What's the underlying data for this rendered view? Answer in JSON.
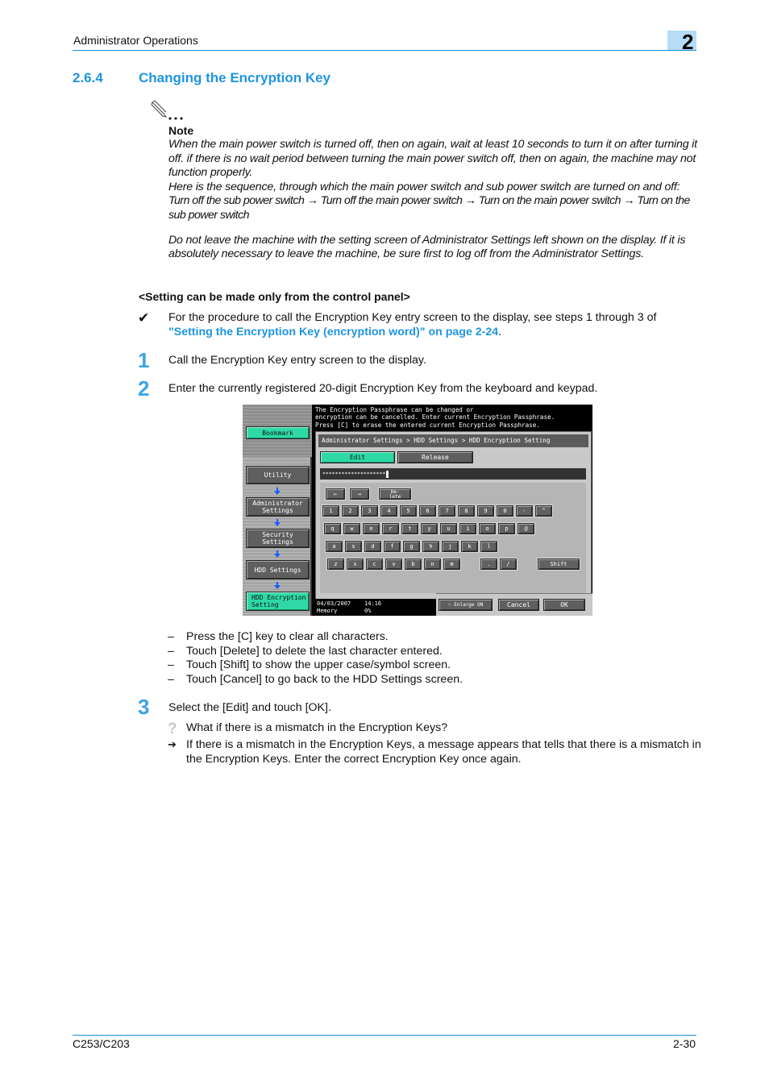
{
  "header": {
    "section_title": "Administrator Operations",
    "chapter_number": "2"
  },
  "section": {
    "number": "2.6.4",
    "title": "Changing the Encryption Key"
  },
  "note": {
    "icon": "pencil-note-icon",
    "label": "Note",
    "paragraphs": [
      "When the main power switch is turned off, then on again, wait at least 10 seconds to turn it on after turning it off. if there is no wait period between turning the main power switch off, then on again, the machine may not function properly.",
      "Here is the sequence, through which the main power switch and sub power switch are turned on and off:",
      "Turn off the sub power switch → Turn off the main power switch → Turn on the main power switch → Turn on the sub power switch",
      "Do not leave the machine with the setting screen of Administrator Settings left shown on the display. If it is absolutely necessary to leave the machine, be sure first to log off from the Administrator Settings."
    ]
  },
  "control_panel_heading": "<Setting can be made only from the control panel>",
  "prerequisite": {
    "icon": "checkmark-icon",
    "text_before": "For the procedure to call the Encryption Key entry screen to the display, see steps 1 through 3 of ",
    "link_text": "\"Setting the Encryption Key (encryption word)\" on page 2-24",
    "text_after": "."
  },
  "steps": [
    {
      "number": "1",
      "text": "Call the Encryption Key entry screen to the display."
    },
    {
      "number": "2",
      "text": "Enter the currently registered 20-digit Encryption Key from the keyboard and keypad."
    },
    {
      "number": "3",
      "text": "Select the [Edit] and touch [OK]."
    }
  ],
  "screen": {
    "sidebar": {
      "bookmark": "Bookmark",
      "path": [
        "Utility",
        "Administrator Settings",
        "Security Settings",
        "HDD Settings",
        "HDD Encryption Setting"
      ]
    },
    "message_lines": [
      "The Encryption Passphrase can be changed or",
      "encryption can be cancelled. Enter current Encryption Passphrase.",
      "Press [C] to erase the entered current Encryption Passphrase."
    ],
    "breadcrumb": "Administrator Settings > HDD Settings > HDD Encryption Setting",
    "tabs": {
      "edit": "Edit",
      "release": "Release",
      "selected": "Edit"
    },
    "input_value": "********************",
    "nav_keys": {
      "left": "←",
      "right": "→",
      "delete": "De-\nlete"
    },
    "keyboard_rows": [
      [
        "1",
        "2",
        "3",
        "4",
        "5",
        "6",
        "7",
        "8",
        "9",
        "0",
        "-",
        "^"
      ],
      [
        "q",
        "w",
        "e",
        "r",
        "t",
        "y",
        "u",
        "i",
        "o",
        "p",
        "@"
      ],
      [
        "a",
        "s",
        "d",
        "f",
        "g",
        "h",
        "j",
        "k",
        "l"
      ],
      [
        "z",
        "x",
        "c",
        "v",
        "b",
        "n",
        "m"
      ],
      [
        ".",
        "/"
      ]
    ],
    "shift_label": "Shift",
    "status": {
      "date": "04/03/2007",
      "time": "14:16",
      "memory_label": "Memory",
      "memory_value": "0%"
    },
    "enlarge_label": "Enlarge ON",
    "cancel_label": "Cancel",
    "ok_label": "OK"
  },
  "step2_notes": [
    "Press the [C] key to clear all characters.",
    "Touch [Delete] to delete the last character entered.",
    "Touch [Shift] to show the upper case/symbol screen.",
    "Touch [Cancel] to go back to the HDD Settings screen."
  ],
  "faq": {
    "question_icon": "question-icon",
    "question": "What if there is a mismatch in the Encryption Keys?",
    "answer_icon": "arrow-right-icon",
    "answer": "If there is a mismatch in the Encryption Keys, a message appears that tells that there is a mismatch in the Encryption Keys. Enter the correct Encryption Key once again."
  },
  "footer": {
    "model": "C253/C203",
    "page": "2-30"
  },
  "colors": {
    "accent": "#1e95e0",
    "rule": "#1e90d8",
    "chapter_box": "#b6dcf6",
    "panel_green": "#2fd9a6"
  }
}
